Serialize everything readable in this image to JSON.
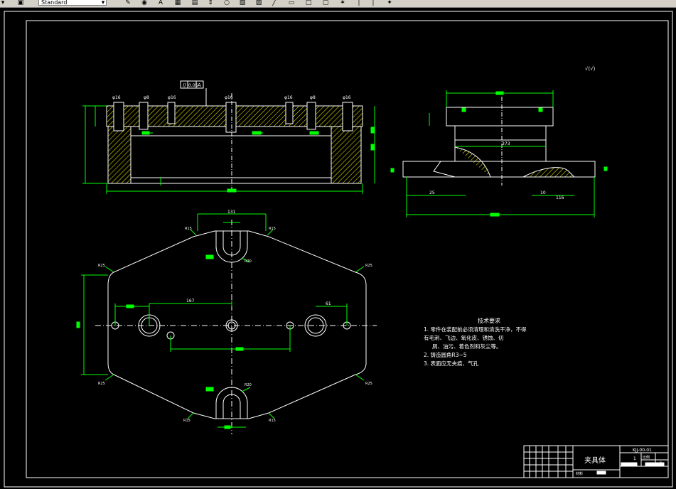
{
  "toolbar": {
    "text_style_value": "Standard",
    "icons": [
      "dropdown-arrow-icon",
      "text-style-icon",
      "combo-arrow-icon",
      "pencil-icon",
      "bucket-icon",
      "abc-icon",
      "table-icon",
      "grid-icon",
      "arrows-icon",
      "circle-icon",
      "hatch-icon",
      "image-icon",
      "line-icon",
      "rectangle-icon",
      "window-icon",
      "star-icon",
      "pipe-icon",
      "eraser-icon"
    ]
  },
  "drawing": {
    "front_view": {
      "tolerance_frame": [
        "//",
        "0.05",
        "A"
      ],
      "dimensions": [
        "φ16",
        "φ8",
        "φ16",
        "φ16",
        "φ16",
        "φ8",
        "φ16"
      ]
    },
    "side_view": {
      "surface_finish_note": "√(√)",
      "dim_total": "373",
      "dim_left": "25",
      "dim_right": "10",
      "dim_right2": "116"
    },
    "plan_view": {
      "dim_top": "131",
      "dim_left_spacing": "167",
      "dim_right_spacing": "61",
      "radius_labels": [
        "R15",
        "R15",
        "R25",
        "R25",
        "R20",
        "R25",
        "R25",
        "R20",
        "R15",
        "R15"
      ]
    },
    "technical_requirements": {
      "title": "技术要求",
      "lines": [
        "1. 零件在装配前必须清理和清洗干净，不得",
        "有毛刺、飞边、氧化皮、锈蚀、切",
        "屑、油污、着色剂和灰尘等。",
        "2. 铸造圆角R3~5",
        "3. 表面应无夹痕、气孔"
      ]
    },
    "title_block": {
      "part_name": "夹具体",
      "drawing_number": "KJJ-00-01",
      "sheet_labels": [
        "1",
        "比例",
        "1"
      ],
      "material_label": "材料"
    }
  },
  "colors": {
    "canvas_bg": "#000000",
    "line_white": "#ffffff",
    "dim_green": "#00ff00",
    "hatch_yellow": "#ffff00",
    "toolbar_bg": "#d4d0c8"
  }
}
